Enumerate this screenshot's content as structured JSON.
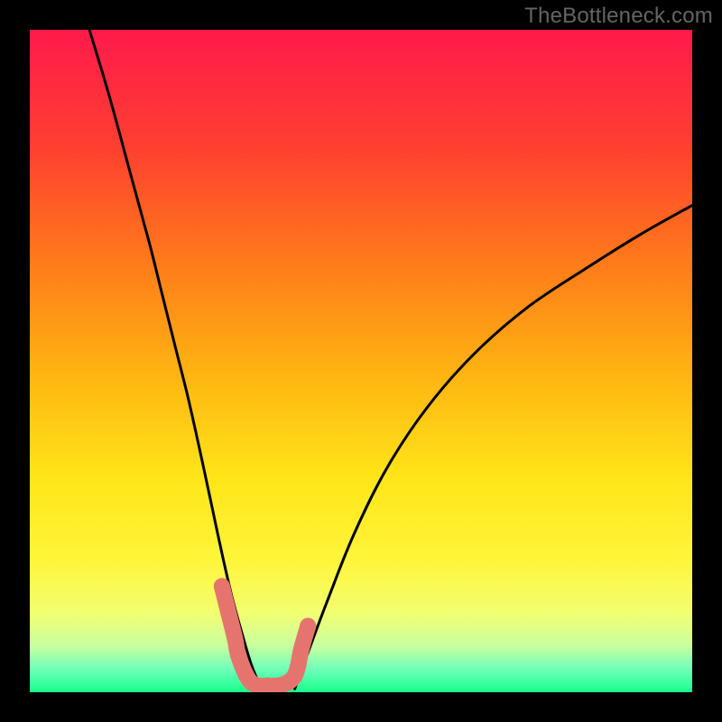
{
  "watermark": "TheBottleneck.com",
  "colors": {
    "frame": "#000000",
    "gradient_stops": [
      {
        "offset": 0.0,
        "color": "#ff1a4b"
      },
      {
        "offset": 0.18,
        "color": "#ff4030"
      },
      {
        "offset": 0.35,
        "color": "#ff7a1a"
      },
      {
        "offset": 0.52,
        "color": "#ffb412"
      },
      {
        "offset": 0.68,
        "color": "#ffe619"
      },
      {
        "offset": 0.8,
        "color": "#fff53a"
      },
      {
        "offset": 0.88,
        "color": "#f2ff70"
      },
      {
        "offset": 0.93,
        "color": "#c9ffa0"
      },
      {
        "offset": 0.965,
        "color": "#6fffb8"
      },
      {
        "offset": 1.0,
        "color": "#18ff8e"
      }
    ],
    "curve_stroke": "#000000",
    "accent_point": "#e6746e"
  },
  "chart_data": {
    "type": "line",
    "title": "",
    "xlabel": "",
    "ylabel": "",
    "xlim": [
      0,
      100
    ],
    "ylim": [
      0,
      100
    ],
    "grid": false,
    "series": [
      {
        "name": "left-curve",
        "x": [
          9,
          12,
          15,
          18,
          20,
          22,
          24,
          26,
          27.5,
          29,
          30.5,
          32,
          33.5,
          35
        ],
        "y": [
          100,
          90,
          79,
          68,
          60,
          52,
          44,
          35,
          28,
          21,
          14.5,
          9,
          4,
          0.5
        ]
      },
      {
        "name": "right-curve",
        "x": [
          40,
          42,
          45,
          49,
          54,
          60,
          67,
          75,
          84,
          92,
          100
        ],
        "y": [
          0.5,
          6,
          14,
          24,
          34,
          43,
          51,
          58,
          64,
          69,
          73.5
        ]
      },
      {
        "name": "accent-cluster",
        "x": [
          29,
          30,
          31,
          31.5,
          33,
          34.5,
          36,
          37.5,
          39,
          40,
          40.5,
          41,
          42
        ],
        "y": [
          16,
          12,
          8,
          5.5,
          2,
          1,
          1,
          1,
          1.5,
          2.5,
          4,
          6.5,
          10
        ]
      }
    ]
  }
}
